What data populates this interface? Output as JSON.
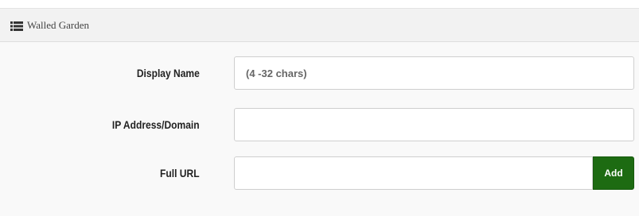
{
  "panel": {
    "title": "Walled Garden",
    "icon": "list-icon"
  },
  "form": {
    "display_name": {
      "label": "Display Name",
      "value": "",
      "placeholder": "(4 -32 chars)"
    },
    "ip_address_domain": {
      "label": "IP Address/Domain",
      "value": "",
      "placeholder": ""
    },
    "full_url": {
      "label": "Full URL",
      "value": "",
      "placeholder": ""
    },
    "add_button_label": "Add"
  },
  "colors": {
    "add_button": "#1d6b12",
    "header_bg": "#f2f2f2",
    "body_bg": "#f9f9f9"
  }
}
